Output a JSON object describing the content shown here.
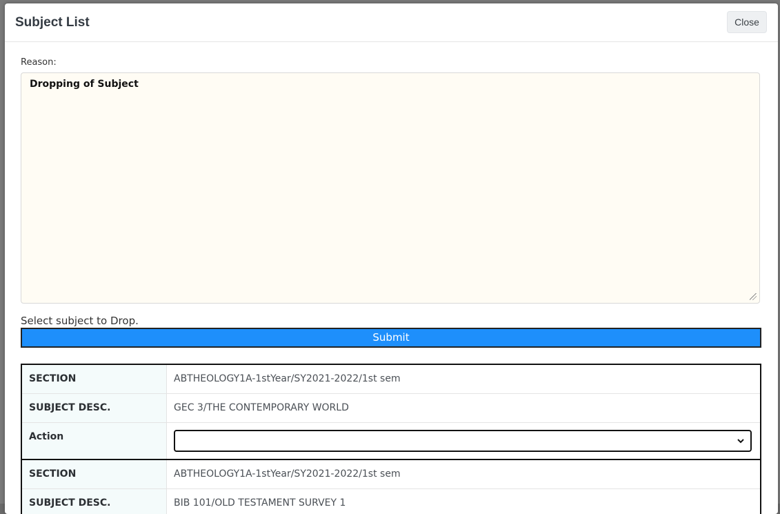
{
  "modal": {
    "title": "Subject List",
    "close_label": "Close"
  },
  "form": {
    "reason_label": "Reason:",
    "reason_value": "Dropping of Subject",
    "select_hint": "Select subject to Drop.",
    "submit_label": "Submit"
  },
  "subjects": [
    {
      "section_label": "SECTION",
      "section_value": "ABTHEOLOGY1A-1stYear/SY2021-2022/1st sem",
      "desc_label": "SUBJECT DESC.",
      "desc_value": "GEC 3/THE CONTEMPORARY WORLD",
      "action_label": "Action",
      "action_value": ""
    },
    {
      "section_label": "SECTION",
      "section_value": "ABTHEOLOGY1A-1stYear/SY2021-2022/1st sem",
      "desc_label": "SUBJECT DESC.",
      "desc_value": "BIB 101/OLD TESTAMENT SURVEY 1"
    }
  ],
  "icons": {
    "select_chevron": "chevron-down-icon",
    "resize_grip": "resize-grip-icon"
  },
  "colors": {
    "submit_bg": "#1e8ffb",
    "textarea_bg": "#fffcf4",
    "header_cell_bg": "#f4fbfb"
  }
}
